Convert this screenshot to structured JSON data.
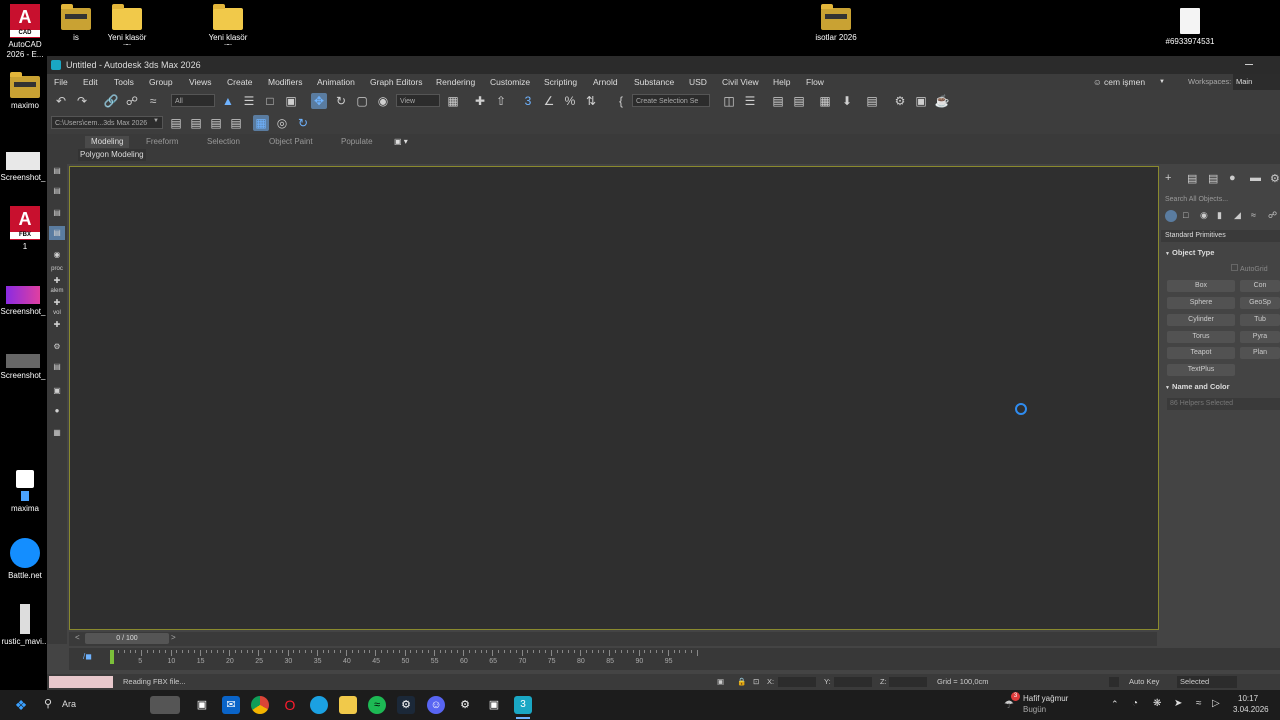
{
  "desktop": {
    "icons": [
      {
        "label": "AutoCAD 2026 - E..."
      },
      {
        "label": "is"
      },
      {
        "label": "Yeni klasör (3)"
      },
      {
        "label": "Yeni klasör (2)"
      },
      {
        "label": "isotlar 2026"
      },
      {
        "label": "#6933974531"
      },
      {
        "label": "maximo"
      },
      {
        "label": "Screenshot_"
      },
      {
        "label": "1"
      },
      {
        "label": "Screenshot_"
      },
      {
        "label": "Screenshot_"
      },
      {
        "label": "maxima"
      },
      {
        "label": "Battle.net"
      },
      {
        "label": "rustic_mavi..."
      }
    ],
    "acad_letter": "A",
    "acad_badge": "CAD",
    "fbx_badge": "FBX"
  },
  "window": {
    "title": "Untitled - Autodesk 3ds Max 2026"
  },
  "menu": {
    "items": [
      "File",
      "Edit",
      "Tools",
      "Group",
      "Views",
      "Create",
      "Modifiers",
      "Animation",
      "Graph Editors",
      "Rendering",
      "Customize",
      "Scripting",
      "Arnold",
      "Substance",
      "USD",
      "Civil View",
      "Help",
      "Flow"
    ],
    "user": "cem işmen",
    "workspaces_label": "Workspaces:",
    "workspace_value": "Main Toolbar"
  },
  "toolbar": {
    "filter_value": "All",
    "coord_value": "View",
    "selection_set_placeholder": "Create Selection Se",
    "path_value": "C:\\Users\\cem...3ds Max 2026"
  },
  "ribbon": {
    "tabs": [
      "Modeling",
      "Freeform",
      "Selection",
      "Object Paint",
      "Populate"
    ],
    "sub_label": "Polygon Modeling"
  },
  "leftbar": {
    "labels": [
      "proc",
      "alem",
      "vol"
    ]
  },
  "command_panel": {
    "search_placeholder": "Search All Objects...",
    "category": "Standard Primitives",
    "object_type_title": "Object Type",
    "autogrid": "AutoGrid",
    "buttons": [
      "Box",
      "Con",
      "Sphere",
      "GeoSp",
      "Cylinder",
      "Tub",
      "Torus",
      "Pyra",
      "Teapot",
      "Plan",
      "TextPlus"
    ],
    "name_color_title": "Name and Color",
    "name_value": "86 Helpers Selected"
  },
  "timeline": {
    "counter": "0 / 100",
    "ticks": [
      "5",
      "10",
      "15",
      "20",
      "25",
      "30",
      "35",
      "40",
      "45",
      "50",
      "55",
      "60",
      "65",
      "70",
      "75",
      "80",
      "85",
      "90",
      "95"
    ]
  },
  "status": {
    "message": "Reading FBX file...",
    "x_label": "X:",
    "y_label": "Y:",
    "z_label": "Z:",
    "grid": "Grid = 100,0cm",
    "autokey": "Auto Key",
    "selected": "Selected"
  },
  "taskbar": {
    "search": "Ara",
    "weather_title": "Hafif yağmur",
    "weather_sub": "Bugün",
    "weather_badge": "3",
    "time": "10:17",
    "date": "3.04.2026"
  },
  "colors": {
    "viewport_border": "#8a8a2e",
    "accent_blue": "#6fb3ff",
    "spinner": "#2f8cf0"
  }
}
